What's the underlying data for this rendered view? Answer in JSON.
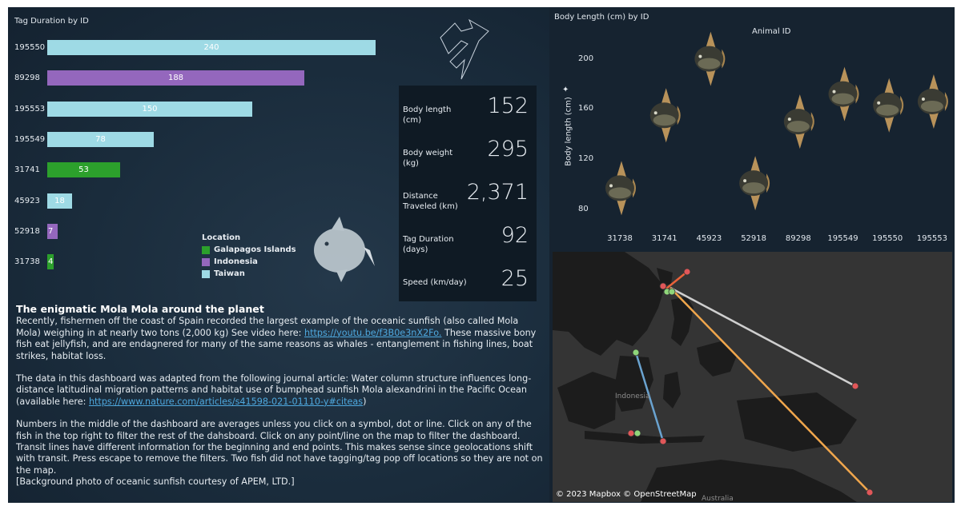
{
  "tag_chart": {
    "title": "Tag Duration by ID",
    "bars": [
      {
        "id": "195550",
        "value": 240,
        "location": "Taiwan"
      },
      {
        "id": "89298",
        "value": 188,
        "location": "Indonesia"
      },
      {
        "id": "195553",
        "value": 150,
        "location": "Taiwan"
      },
      {
        "id": "195549",
        "value": 78,
        "location": "Taiwan"
      },
      {
        "id": "31741",
        "value": 53,
        "location": "Galapagos Islands"
      },
      {
        "id": "45923",
        "value": 18,
        "location": "Taiwan"
      },
      {
        "id": "52918",
        "value": 7,
        "location": "Indonesia"
      },
      {
        "id": "31738",
        "value": 4,
        "location": "Galapagos Islands"
      }
    ]
  },
  "legend": {
    "title": "Location",
    "items": [
      {
        "label": "Galapagos Islands",
        "color": "#2ca02c"
      },
      {
        "label": "Indonesia",
        "color": "#9467bd"
      },
      {
        "label": "Taiwan",
        "color": "#9edae5"
      }
    ]
  },
  "kpis": [
    {
      "label": "Body length (cm)",
      "value": "152"
    },
    {
      "label": "Body weight (kg)",
      "value": "295"
    },
    {
      "label": "Distance Traveled (km)",
      "value": "2,371"
    },
    {
      "label": "Tag Duration (days)",
      "value": "92"
    },
    {
      "label": "Speed (km/day)",
      "value": "25"
    }
  ],
  "article": {
    "heading": "The enigmatic Mola Mola around the planet",
    "p1_text": "Recently, fishermen off the coast of Spain recorded the largest example of the oceanic sunfish (also called Mola Mola) weighing in at nearly two tons (2,000 kg) See video here: ",
    "p1_link": "https://youtu.be/f3B0e3nX2Fo.",
    "p1_tail": " These massive bony fish eat jellyfish, and are endagnered for many of the same reasons as whales - entanglement in fishing lines, boat strikes, habitat loss.",
    "p2_text": "The data in this dashboard was adapted from the following journal article: Water column structure influences long-distance latitudinal migration patterns and habitat use of bumphead sunfish Mola alexandrini in the Pacific Ocean (available here: ",
    "p2_link": "https://www.nature.com/articles/s41598-021-01110-y#citeas",
    "p2_tail": ")",
    "p3_text": "Numbers in the middle of the dashboard are averages unless you click on a symbol, dot or line. Click on any of the fish in the top right to filter the rest of the dahsboard. Click on any point/line on the map to filter the dashboard. Transit lines have different information for the beginning and end points. This makes sense since geolocations shift with transit. Press escape to remove the filters. Two fish did not have tagging/tag pop off locations so they are not on the map.",
    "p4_text": "[Background photo of oceanic sunfish courtesy of APEM, LTD.]"
  },
  "body_chart": {
    "title": "Body Length (cm) by ID",
    "subtitle": "Animal ID",
    "ylabel": "Body length (cm)",
    "yticks": [
      80,
      120,
      160,
      200
    ],
    "ylim": [
      68,
      222
    ],
    "points": [
      {
        "id": "31738",
        "value": 97
      },
      {
        "id": "31741",
        "value": 155
      },
      {
        "id": "45923",
        "value": 200
      },
      {
        "id": "52918",
        "value": 101
      },
      {
        "id": "89298",
        "value": 150
      },
      {
        "id": "195549",
        "value": 172
      },
      {
        "id": "195550",
        "value": 163
      },
      {
        "id": "195553",
        "value": 166
      }
    ]
  },
  "chart_data": {
    "type": "bar",
    "title": "Tag Duration by ID",
    "categories": [
      "195550",
      "89298",
      "195553",
      "195549",
      "31741",
      "45923",
      "52918",
      "31738"
    ],
    "values": [
      240,
      188,
      150,
      78,
      53,
      18,
      7,
      4
    ],
    "legend": [
      "Galapagos Islands",
      "Indonesia",
      "Taiwan"
    ]
  },
  "map": {
    "credit": "© 2023 Mapbox © OpenStreetMap",
    "labels": {
      "indonesia": "Indonesia",
      "australia": "Australia"
    }
  },
  "colors": {
    "taiwan": "#9edae5",
    "indonesia": "#9467bd",
    "galapagos": "#2ca02c",
    "start_point": "#8fd67a",
    "end_point": "#e15759"
  }
}
